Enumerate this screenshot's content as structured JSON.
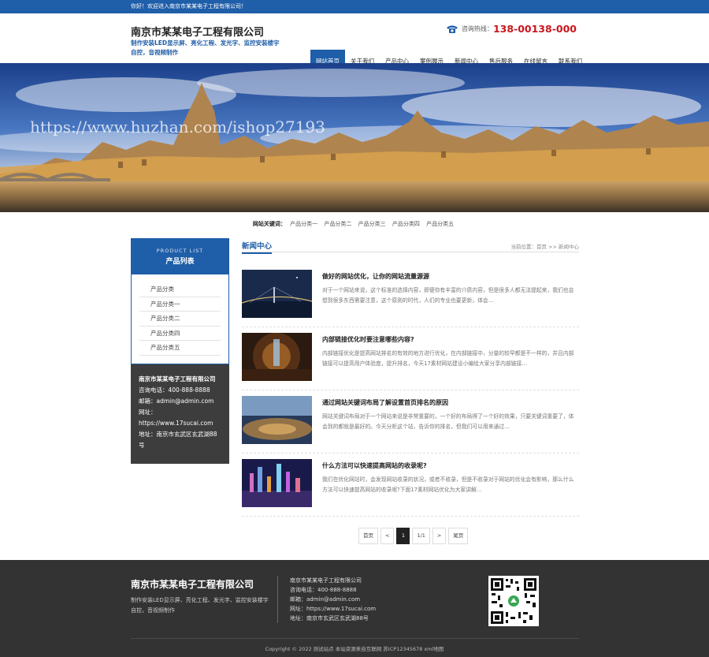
{
  "topbar": {
    "welcome": "你好！欢迎进入南京市某某电子工程有限公司！"
  },
  "header": {
    "company": "南京市某某电子工程有限公司",
    "slogan": "制作安装LED显示屏、亮化工程、发光字、监控安装楼宇自控，音视频制作",
    "hotline_label": "咨询热线：",
    "hotline_number": "138-00138-000"
  },
  "nav": [
    "网站首页",
    "关于我们",
    "产品中心",
    "案例展示",
    "新闻中心",
    "售后服务",
    "在线留言",
    "联系我们"
  ],
  "banner": {
    "watermark": "https://www.huzhan.com/ishop27193"
  },
  "keywords": {
    "label": "网站关键词：",
    "items": [
      "产品分类一",
      "产品分类二",
      "产品分类三",
      "产品分类四",
      "产品分类五"
    ]
  },
  "sidebar": {
    "head_en": "PRODUCT LIST",
    "head_cn": "产品列表",
    "items": [
      "产品分类",
      "产品分类一",
      "产品分类二",
      "产品分类四",
      "产品分类五"
    ],
    "contact": {
      "company": "南京市某某电子工程有限公司",
      "phone": "咨询电话：400-888-8888",
      "email": "邮箱：admin@admin.com",
      "site": "网址：https://www.17sucai.com",
      "address": "地址：南京市玄武区玄武湖88号"
    }
  },
  "main": {
    "title": "新闻中心",
    "breadcrumb": "当前位置：首页 >> 新闻中心",
    "news": [
      {
        "title": "做好的网站优化，让你的网站流量源源",
        "desc": "对于一个网站来说，这个标准的选择内容，即便你有丰富的介质内容，但是很多人都无法提起来，我们也会想到很多东西需要注意，这个原则的时代，人们的专业也要更新，体会…"
      },
      {
        "title": "内部链接优化时要注意哪些内容?",
        "desc": "内部链接优化是提高网站排名的有效的地方进行优化，在内部链接中，分量的较早都是不一样的，并且内部链接可以提高用户体验度，提升排名，今天17素材网站建设小编给大家分享内部链接…"
      },
      {
        "title": "通过网站关键词布局了解设置首页排名的原因",
        "desc": "网站关键词布局对于一个网站来说是非常重要的，一个好的布局得了一个好的效果，只要关键词重要了，体会到的都就是最好的。今天分析这个站，告诉你的排名，但我们可以用来通过…"
      },
      {
        "title": "什么方法可以快速提高网站的收录呢?",
        "desc": "我们在优化网站时，会发现网站收录的状况，或者不收录，但是不收录对于网站的优化会有影响，那么什么方法可以快速提高网站的收录呢?下面17素材网站优化为大家讲解…"
      }
    ]
  },
  "pager": [
    "首页",
    "<",
    "1",
    "1/1",
    ">",
    "尾页"
  ],
  "footer": {
    "company": "南京市某某电子工程有限公司",
    "slogan": "制作安装LED显示屏、亮化工程、发光字、监控安装楼宇自控，音视频制作",
    "info": [
      "南京市某某电子工程有限公司",
      "咨询电话：400-888-8888",
      "邮箱：admin@admin.com",
      "网址：https://www.17sucai.com",
      "地址：南京市玄武区玄武湖88号"
    ],
    "copyright": "Copyright © 2022 测试站点 本站资源来自互联网  苏ICP12345678  xml地图"
  },
  "colors": {
    "brand": "#1f5ea8",
    "hotline": "#c8161d",
    "footer_bg": "#333333"
  }
}
